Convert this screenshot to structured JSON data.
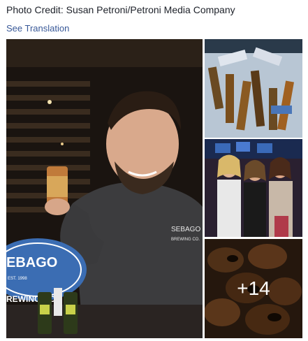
{
  "post": {
    "credit_text": "Photo Credit: Susan Petroni/Petroni Media Company",
    "see_translation": "See Translation"
  },
  "photos": {
    "main": {
      "shirt_logo": "SEBAGO",
      "shirt_sub": "BREWING CO.",
      "sign_top": "EBAGO",
      "sign_bottom": "REWING CO",
      "sign_est": "EST. 1998"
    },
    "more_count": "+14"
  },
  "colors": {
    "link": "#385898",
    "text": "#1d2129"
  }
}
